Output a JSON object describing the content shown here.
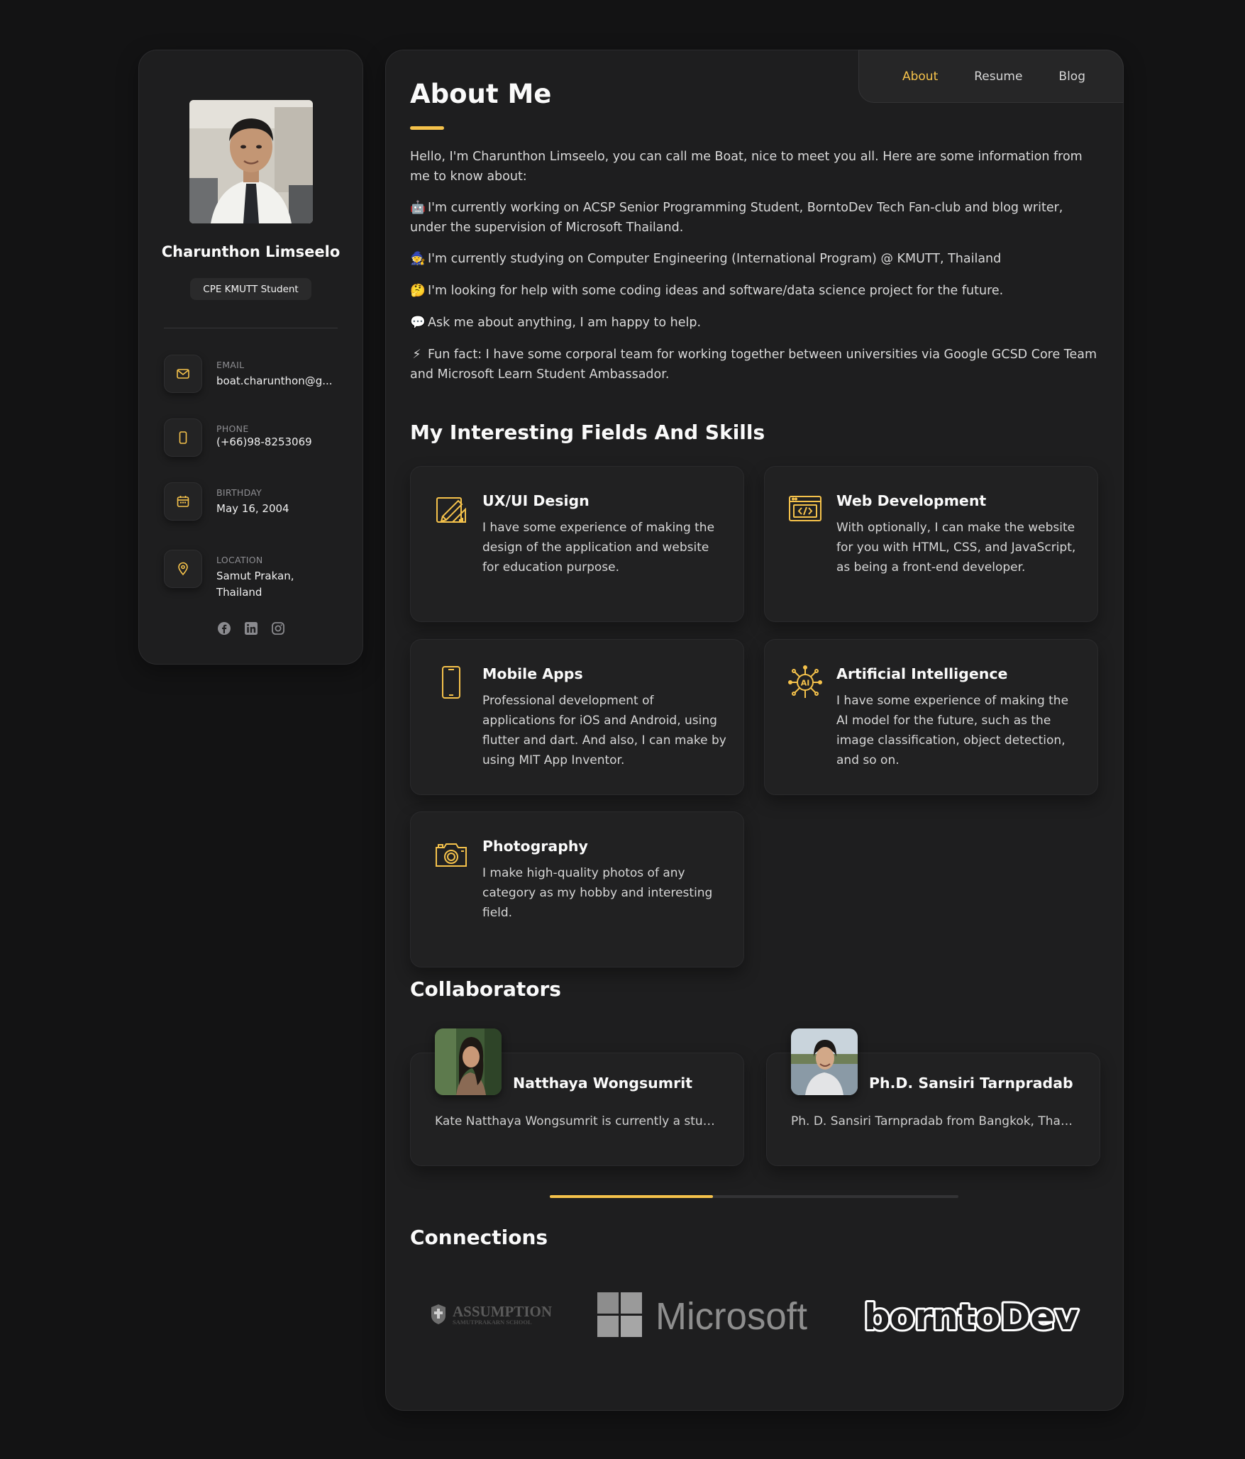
{
  "colors": {
    "accent": "#f5c24b",
    "background": "#131314",
    "card": "#1e1e1f",
    "text": "#fafafa"
  },
  "sidebar": {
    "name": "Charunthon Limseelo",
    "title": "CPE KMUTT Student",
    "contacts": [
      {
        "icon": "mail-icon",
        "label": "EMAIL",
        "value": "boat.charunthon@g..."
      },
      {
        "icon": "phone-icon",
        "label": "PHONE",
        "value": "(+66)98-8253069"
      },
      {
        "icon": "calendar-icon",
        "label": "BIRTHDAY",
        "value": "May 16, 2004"
      },
      {
        "icon": "location-pin-icon",
        "label": "LOCATION",
        "value": "Samut Prakan, Thailand"
      }
    ],
    "socials": [
      "facebook-icon",
      "linkedin-icon",
      "instagram-icon"
    ]
  },
  "nav": {
    "items": [
      {
        "label": "About",
        "active": true
      },
      {
        "label": "Resume",
        "active": false
      },
      {
        "label": "Blog",
        "active": false
      }
    ]
  },
  "about": {
    "heading": "About Me",
    "paragraphs": [
      {
        "emoji": "",
        "text": "Hello, I'm Charunthon Limseelo, you can call me Boat, nice to meet you all. Here are some information from me to know about:"
      },
      {
        "emoji": "🤖",
        "text": "I'm currently working on ACSP Senior Programming Student, BorntoDev Tech Fan-club and blog writer, under the supervision of Microsoft Thailand."
      },
      {
        "emoji": "🧙",
        "text": "I'm currently studying on Computer Engineering (International Program) @ KMUTT, Thailand"
      },
      {
        "emoji": "🤔",
        "text": "I'm looking for help with some coding ideas and software/data science project for the future."
      },
      {
        "emoji": "💬",
        "text": "Ask me about anything, I am happy to help."
      },
      {
        "emoji": "⚡",
        "text": "Fun fact: I have some corporal team for working together between universities via Google GCSD Core Team and Microsoft Learn Student Ambassador."
      }
    ]
  },
  "skills": {
    "heading": "My Interesting Fields And Skills",
    "items": [
      {
        "icon": "design-pencil-ruler-icon",
        "title": "UX/UI Design",
        "desc": "I have some experience of making the design of the application and website for education purpose."
      },
      {
        "icon": "code-window-icon",
        "title": "Web Development",
        "desc": "With optionally, I can make the website for you with HTML, CSS, and JavaScript, as being a front-end developer."
      },
      {
        "icon": "mobile-phone-icon",
        "title": "Mobile Apps",
        "desc": "Professional development of applications for iOS and Android, using flutter and dart. And also, I can make by using MIT App Inventor."
      },
      {
        "icon": "ai-chip-icon",
        "title": "Artificial Intelligence",
        "desc": "I have some experience of making the AI model for the future, such as the image classification, object detection, and so on."
      },
      {
        "icon": "camera-icon",
        "title": "Photography",
        "desc": "I make high-quality photos of any category as my hobby and interesting field."
      }
    ]
  },
  "collaborators": {
    "heading": "Collaborators",
    "scroll_progress": 0.4,
    "items": [
      {
        "name": "Natthaya Wongsumrit",
        "desc": "Kate Natthaya Wongsumrit is currently a student at Vajira Hospital Medical School. Sh..."
      },
      {
        "name": "Ph.D. Sansiri Tarnpradab",
        "desc": "Ph. D. Sansiri Tarnpradab from Bangkok, Thailand, recently graduated with a Ph.D. fro..."
      }
    ]
  },
  "connections": {
    "heading": "Connections",
    "logos": [
      {
        "name": "ASSUMPTION",
        "sub": "SAMUTPRAKARN SCHOOL"
      },
      {
        "name": "Microsoft"
      },
      {
        "name": "borntoDev"
      }
    ]
  }
}
